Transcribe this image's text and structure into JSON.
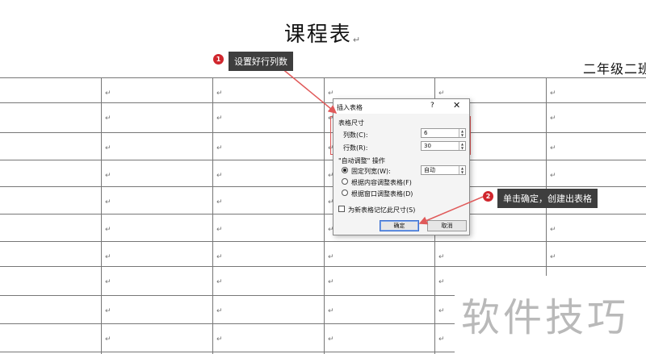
{
  "document": {
    "title": "课程表",
    "title_mark": "↵",
    "class_label": "二年级二班",
    "cell_mark": "↵"
  },
  "callouts": [
    {
      "number": "1",
      "text": "设置好行列数"
    },
    {
      "number": "2",
      "text": "单击确定，创建出表格"
    }
  ],
  "dialog": {
    "title": "插入表格",
    "help": "?",
    "close": "✕",
    "section_size": "表格尺寸",
    "columns_label": "列数(C):",
    "columns_value": "6",
    "rows_label": "行数(R):",
    "rows_value": "30",
    "section_autofit": "\"自动调整\" 操作",
    "radio_fixed": "固定列宽(W):",
    "fixed_value": "自动",
    "radio_content": "根据内容调整表格(F)",
    "radio_window": "根据窗口调整表格(D)",
    "remember_label": "为新表格记忆此尺寸(S)",
    "ok_label": "确定",
    "cancel_label": "取消"
  },
  "watermark": "软件技巧",
  "colors": {
    "callout_bg": "#3e3e3e",
    "badge": "#d0262d",
    "annotation_red": "#e05a5a",
    "primary_button_border": "#3a6fd0"
  }
}
